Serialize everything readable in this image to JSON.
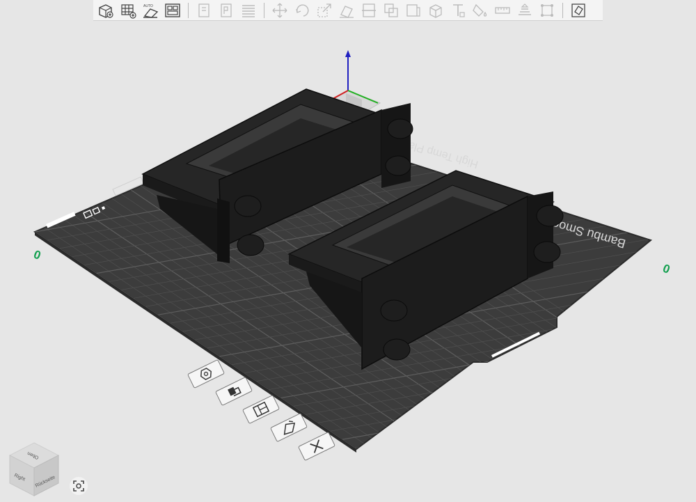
{
  "toolbar": {
    "groups": [
      [
        "add-icon",
        "add-plate-icon",
        "auto-orient-icon",
        "arrange-icon"
      ],
      [
        "split-objects-icon",
        "split-parts-icon",
        "layers-icon"
      ],
      [
        "move-icon",
        "rotate-icon",
        "scale-icon",
        "lay-on-face-icon",
        "cut-icon",
        "boolean-icon",
        "support-paint-icon",
        "seam-paint-icon",
        "text-icon",
        "color-paint-icon",
        "measure-icon",
        "assembly-icon",
        "fit-icon"
      ],
      [
        "variable-layer-icon"
      ]
    ],
    "auto_label": "AUTO"
  },
  "plate": {
    "brand_text": "Bambu Smooth PEI",
    "temp_text": "High Temp Plate",
    "axis_origin_label": "0",
    "axis_far_label": "0",
    "colors": {
      "bed": "#3c3c3c",
      "grid": "#505050",
      "grid_major": "#5e5e5e",
      "part": "#1e1e1e",
      "part_edge": "#0e0e0e",
      "axis_label": "#14a050"
    }
  },
  "bottom_tools": [
    {
      "name": "orient-icon"
    },
    {
      "name": "filament-icon"
    },
    {
      "name": "arrange-plate-icon"
    },
    {
      "name": "plate-settings-icon"
    },
    {
      "name": "delete-plate-icon"
    }
  ],
  "viewcube": {
    "top_label": "Oben",
    "left_label": "Right",
    "right_label": "Rückseite"
  }
}
